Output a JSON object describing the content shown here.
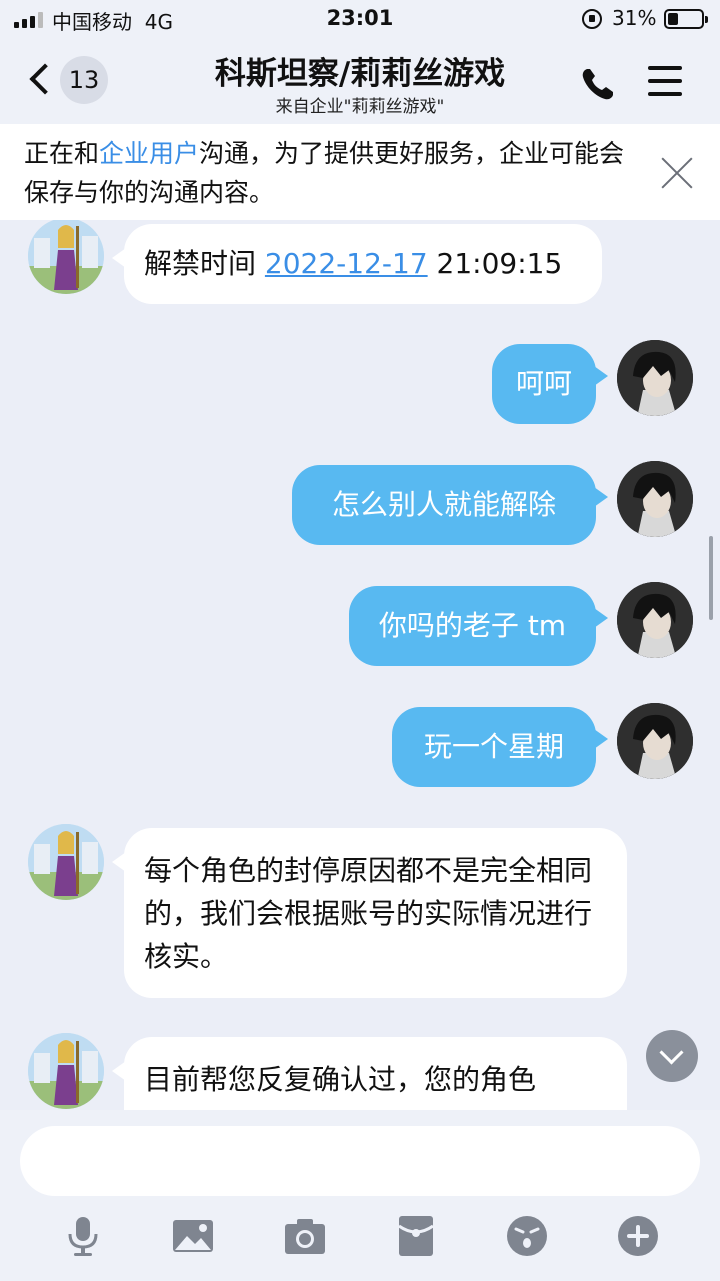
{
  "status_bar": {
    "carrier": "中国移动",
    "network": "4G",
    "time": "23:01",
    "battery_percent": "31%",
    "battery_level": 0.31
  },
  "nav": {
    "back_badge": "13",
    "title": "科斯坦察/莉莉丝游戏",
    "subtitle": "来自企业\"莉莉丝游戏\""
  },
  "notice": {
    "prefix": "正在和",
    "highlight": "企业用户",
    "suffix": "沟通，为了提供更好服务，企业可能会保存与你的沟通内容。"
  },
  "messages": [
    {
      "side": "left",
      "prefix": "解禁时间 ",
      "link": "2022-12-17",
      "suffix": " 21:09:15"
    },
    {
      "side": "right",
      "text": "呵呵"
    },
    {
      "side": "right",
      "text": "怎么别人就能解除"
    },
    {
      "side": "right",
      "text": "你吗的老子 tm"
    },
    {
      "side": "right",
      "text": "玩一个星期"
    },
    {
      "side": "left",
      "text": "每个角色的封停原因都不是完全相同的，我们会根据账号的实际情况进行核实。"
    },
    {
      "side": "left",
      "text": "目前帮您反复确认过，您的角色"
    }
  ],
  "colors": {
    "accent_blue": "#58b9f1",
    "link_blue": "#3a8ee6",
    "background": "#ebeef7"
  },
  "icons": {
    "toolbar": [
      "microphone-icon",
      "image-icon",
      "camera-icon",
      "red-packet-icon",
      "emoji-icon",
      "plus-icon"
    ]
  }
}
